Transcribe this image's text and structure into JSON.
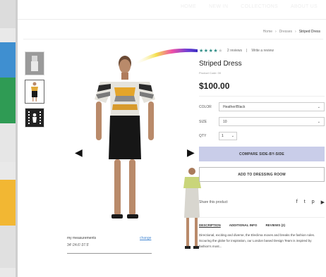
{
  "nav": {
    "links": [
      "HOME",
      "NEW IN",
      "COLLECTIONS",
      "ABOUT US"
    ]
  },
  "breadcrumb": {
    "items": [
      "Home",
      "Dresses",
      "Striped Dress"
    ]
  },
  "viewer": {
    "thumbnails": [
      "dress-front-thumb",
      "dress-avatar-thumb",
      "video-thumb"
    ],
    "measurements_label": "my measurements",
    "measurements_value": "34'-24.6'-37.5'",
    "change_link": "change"
  },
  "product": {
    "reviews_count": "2 reviews",
    "write_review": "Write a review",
    "rating": 4,
    "rating_max": 5,
    "title": "Striped Dress",
    "code": "Product Code: 00",
    "price": "$100.00",
    "color_label": "COLOR",
    "color_value": "Heather/Black",
    "size_label": "SIZE",
    "size_value": "10",
    "qty_label": "QTY",
    "qty_value": "1",
    "compare_button": "COMPARE SIDE-BY-SIDE",
    "dressing_button": "ADD TO DRESSING ROOM",
    "share_label": "Share this product",
    "tabs": [
      "DESCRIPTION",
      "ADDITIONAL INFO",
      "REVIEWS (2)"
    ],
    "description": "Directional, exciting and diverse, the Eleclima moves and breaks the fashion rules. Scouring the globe for inspiration, our London based Design Team is inspired by fashion's most..."
  },
  "colors": {
    "accent": "#2f8d86",
    "compare_bg": "#c9cde9"
  }
}
